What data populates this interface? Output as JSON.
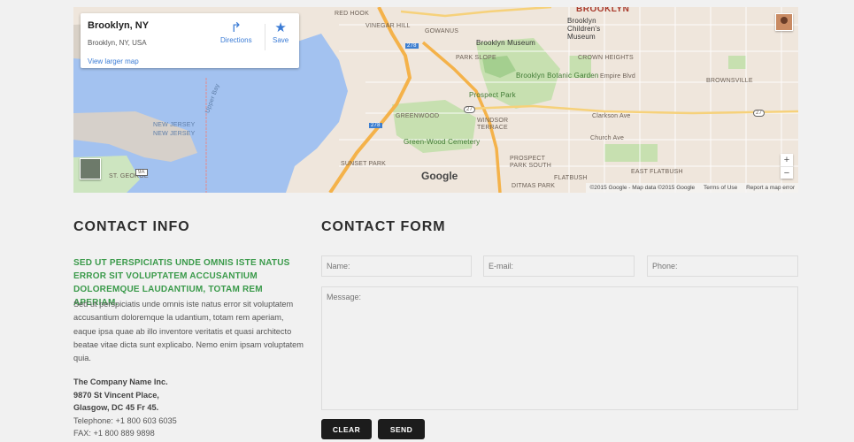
{
  "map": {
    "info": {
      "title": "Brooklyn, NY",
      "subtitle": "Brooklyn, NY, USA",
      "larger_map_link": "View larger map",
      "directions_label": "Directions",
      "save_label": "Save"
    },
    "labels": {
      "brooklyn": "BROOKLYN",
      "red_hook": "RED HOOK",
      "gowanus": "GOWANUS",
      "brooklyn_museum": "Brooklyn Museum",
      "childrens_museum": "Brooklyn Children's Museum",
      "park_slope": "PARK SLOPE",
      "crown_heights": "CROWN HEIGHTS",
      "botanic_garden": "Brooklyn Botanic Garden",
      "prospect_park": "Prospect Park",
      "empire_blvd": "Empire Blvd",
      "new_jersey": "NEW JERSEY",
      "new_jersey_2": "NEW JERSEY",
      "greenwood": "GREENWOOD",
      "greenwood_cemetery": "Green-Wood Cemetery",
      "windsor_terrace": "WINDSOR TERRACE",
      "clarkson_ave": "Clarkson Ave",
      "brownsville": "BROWNSVILLE",
      "church_ave": "Church Ave",
      "sunset_park": "SUNSET PARK",
      "prospect_park_south": "PROSPECT PARK SOUTH",
      "east_flatbush": "EAST FLATBUSH",
      "flatbush": "FLATBUSH",
      "ditmas_park": "DITMAS PARK",
      "st_george": "ST. GEORGE",
      "upper_bay": "Upper Bay",
      "vinegar_hill": "VINEGAR HILL",
      "route_278": "278",
      "route_278b": "278",
      "route_27": "27",
      "route_27b": "27",
      "route_9a": "9A"
    },
    "google_logo": "Google",
    "footer": {
      "copyright": "©2015 Google - Map data ©2015 Google",
      "terms": "Terms of Use",
      "report": "Report a map error"
    },
    "zoom_in": "+",
    "zoom_out": "−"
  },
  "contact_info": {
    "heading": "CONTACT INFO",
    "lead": "SED UT PERSPICIATIS UNDE OMNIS ISTE NATUS ERROR SIT VOLUPTATEM ACCUSANTIUM DOLOREMQUE LAUDANTIUM, TOTAM REM APERIAM.",
    "body": "Sed ut perspiciatis unde omnis iste natus error sit voluptatem accusantium doloremque la udantium, totam rem aperiam, eaque ipsa quae ab illo inventore veritatis et quasi architecto beatae vitae dicta sunt explicabo. Nemo enim ipsam voluptatem quia.",
    "company": "The Company Name Inc.",
    "address_line1": "9870 St Vincent Place,",
    "address_line2": "Glasgow, DC 45 Fr 45.",
    "telephone": "Telephone: +1 800 603 6035",
    "fax": "FAX: +1 800 889 9898"
  },
  "contact_form": {
    "heading": "CONTACT FORM",
    "name_placeholder": "Name:",
    "email_placeholder": "E-mail:",
    "phone_placeholder": "Phone:",
    "message_placeholder": "Message:",
    "clear_label": "CLEAR",
    "send_label": "SEND"
  }
}
